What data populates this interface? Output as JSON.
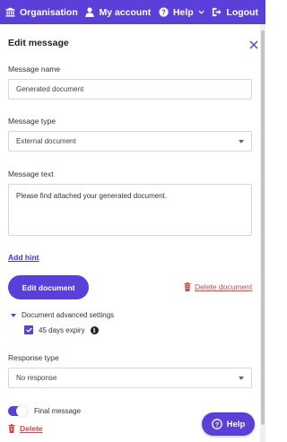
{
  "nav": {
    "organisation": "Organisation",
    "my_account": "My account",
    "help": "Help",
    "logout": "Logout"
  },
  "modal": {
    "title": "Edit message"
  },
  "fields": {
    "message_name_label": "Message name",
    "message_name_value": "Generated document",
    "message_type_label": "Message type",
    "message_type_value": "External document",
    "message_text_label": "Message text",
    "message_text_value": "Please find attached your generated document.",
    "add_hint": "Add hint",
    "edit_document": "Edit document",
    "delete_document": "Delete document",
    "advanced_settings": "Document advanced settings",
    "expiry": "45 days expiry",
    "expiry_checked": true,
    "response_type_label": "Response type",
    "response_type_value": "No response",
    "final_message": "Final message",
    "final_message_on": true,
    "delete": "Delete"
  },
  "help_button": "Help",
  "colors": {
    "primary": "#5b3fd9",
    "danger": "#d64545"
  },
  "icons": {
    "organisation": "bank-icon",
    "my_account": "user-icon",
    "help": "question-circle-icon",
    "logout": "logout-icon",
    "close": "close-icon",
    "trash": "trash-icon",
    "info": "info-icon",
    "check": "check-icon"
  }
}
